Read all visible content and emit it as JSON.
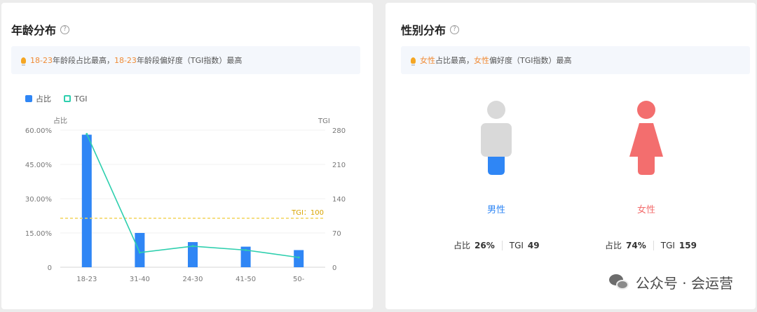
{
  "age_panel": {
    "title": "年龄分布",
    "help_icon": "?",
    "tip": {
      "hl1": "18-23",
      "t1": "年龄段占比最高，",
      "hl2": "18-23",
      "t2": "年龄段偏好度（TGI指数）最高"
    }
  },
  "gender_panel": {
    "title": "性别分布",
    "help_icon": "?",
    "tip": {
      "hl1": "女性",
      "t1": "占比最高，",
      "hl2": "女性",
      "t2": "偏好度（TGI指数）最高"
    },
    "male": {
      "label": "男性",
      "share_label": "占比",
      "share": "26%",
      "tgi_label": "TGI",
      "tgi": "49"
    },
    "female": {
      "label": "女性",
      "share_label": "占比",
      "share": "74%",
      "tgi_label": "TGI",
      "tgi": "159"
    }
  },
  "watermark": "公众号 · 会运营",
  "colors": {
    "bar": "#2f86f5",
    "tgi_line": "#2ecfae",
    "baseline": "#f2d35a",
    "male": "#2f86f5",
    "female": "#f36e6e",
    "figure_gray": "#d9d9d9",
    "accent": "#f08b36"
  },
  "chart_data": {
    "type": "bar",
    "categories": [
      "18-23",
      "31-40",
      "24-30",
      "41-50",
      "50-"
    ],
    "series": [
      {
        "name": "占比",
        "type": "bar",
        "axis": "left",
        "values": [
          58,
          15,
          11,
          9,
          7.5
        ]
      },
      {
        "name": "TGI",
        "type": "line",
        "axis": "right",
        "values": [
          272,
          30,
          43,
          35,
          20
        ]
      }
    ],
    "ylabel": "占比",
    "y2label": "TGI",
    "ylim": [
      0,
      60
    ],
    "y2lim": [
      0,
      280
    ],
    "yticks": [
      "0",
      "15.00%",
      "30.00%",
      "45.00%",
      "60.00%"
    ],
    "y2ticks": [
      "0",
      "70",
      "140",
      "210",
      "280"
    ],
    "reference_line": {
      "axis": "right",
      "value": 100,
      "label": "TGI：100"
    },
    "legend": "top-left",
    "grid": true
  }
}
